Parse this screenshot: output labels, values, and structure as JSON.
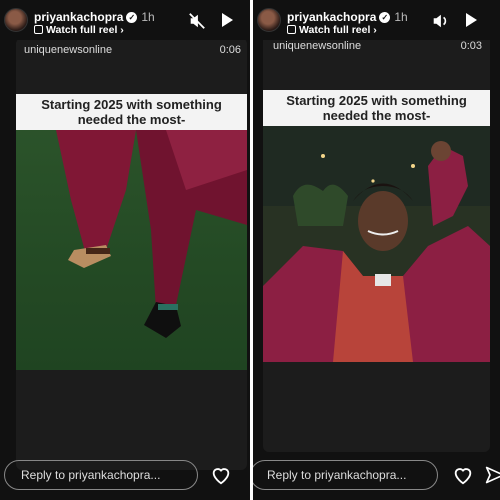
{
  "stories": [
    {
      "username": "priyankachopra",
      "time": "1h",
      "watch_label": "Watch full reel",
      "source": "uniquenewsonline",
      "duration": "0:06",
      "caption_line1": "Starting 2025 with something",
      "caption_line2": "needed the most-",
      "reply_placeholder": "Reply to priyankachopra..."
    },
    {
      "username": "priyankachopra",
      "time": "1h",
      "watch_label": "Watch full reel",
      "source": "uniquenewsonline",
      "duration": "0:03",
      "caption_line1": "Starting 2025 with something",
      "caption_line2": "needed the most-",
      "reply_placeholder": "Reply to priyankachopra..."
    }
  ],
  "icons": {
    "left_audio": "speaker-muted-icon",
    "right_audio": "speaker-on-icon",
    "play": "play-icon",
    "heart": "heart-icon",
    "send": "send-icon"
  }
}
